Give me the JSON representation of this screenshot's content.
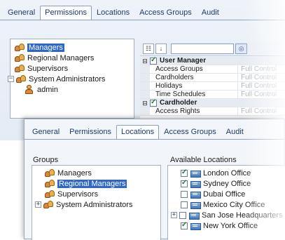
{
  "back_window": {
    "tabs": [
      "General",
      "Permissions",
      "Locations",
      "Access Groups",
      "Audit"
    ],
    "active_tab": 1,
    "tree": [
      {
        "label": "Managers",
        "selected": true,
        "expander": ""
      },
      {
        "label": "Regional Managers",
        "selected": false,
        "expander": ""
      },
      {
        "label": "Supervisors",
        "selected": false,
        "expander": ""
      },
      {
        "label": "System Administrators",
        "selected": false,
        "expander": "⊟"
      },
      {
        "label": "admin",
        "selected": false,
        "expander": "",
        "user": true
      }
    ],
    "grid": {
      "rows": [
        {
          "kind": "cat",
          "name": "User Manager",
          "checked": true
        },
        {
          "kind": "item",
          "name": "Access Groups",
          "value": "Full Control"
        },
        {
          "kind": "item",
          "name": "Cardholders",
          "value": "Full Control"
        },
        {
          "kind": "item",
          "name": "Holidays",
          "value": "Full Control"
        },
        {
          "kind": "item",
          "name": "Time Schedules",
          "value": "Full Control"
        },
        {
          "kind": "cat",
          "name": "Cardholder",
          "checked": true
        },
        {
          "kind": "item",
          "name": "Access Rights",
          "value": "Full Control"
        }
      ]
    }
  },
  "front_window": {
    "tabs": [
      "General",
      "Permissions",
      "Locations",
      "Access Groups",
      "Audit"
    ],
    "active_tab": 2,
    "groups_label": "Groups",
    "locations_label": "Available Locations",
    "groups": [
      {
        "label": "Managers",
        "selected": false,
        "expander": ""
      },
      {
        "label": "Regional Managers",
        "selected": true,
        "expander": ""
      },
      {
        "label": "Supervisors",
        "selected": false,
        "expander": ""
      },
      {
        "label": "System Administrators",
        "selected": false,
        "expander": "+"
      }
    ],
    "locations": [
      {
        "label": "London Office",
        "checked": true,
        "expander": ""
      },
      {
        "label": "Sydney Office",
        "checked": true,
        "expander": ""
      },
      {
        "label": "Dubai Office",
        "checked": false,
        "expander": ""
      },
      {
        "label": "Mexico City Office",
        "checked": false,
        "expander": ""
      },
      {
        "label": "San Jose Headquarters",
        "checked": false,
        "expander": "+"
      },
      {
        "label": "New York Office",
        "checked": true,
        "expander": ""
      }
    ]
  }
}
